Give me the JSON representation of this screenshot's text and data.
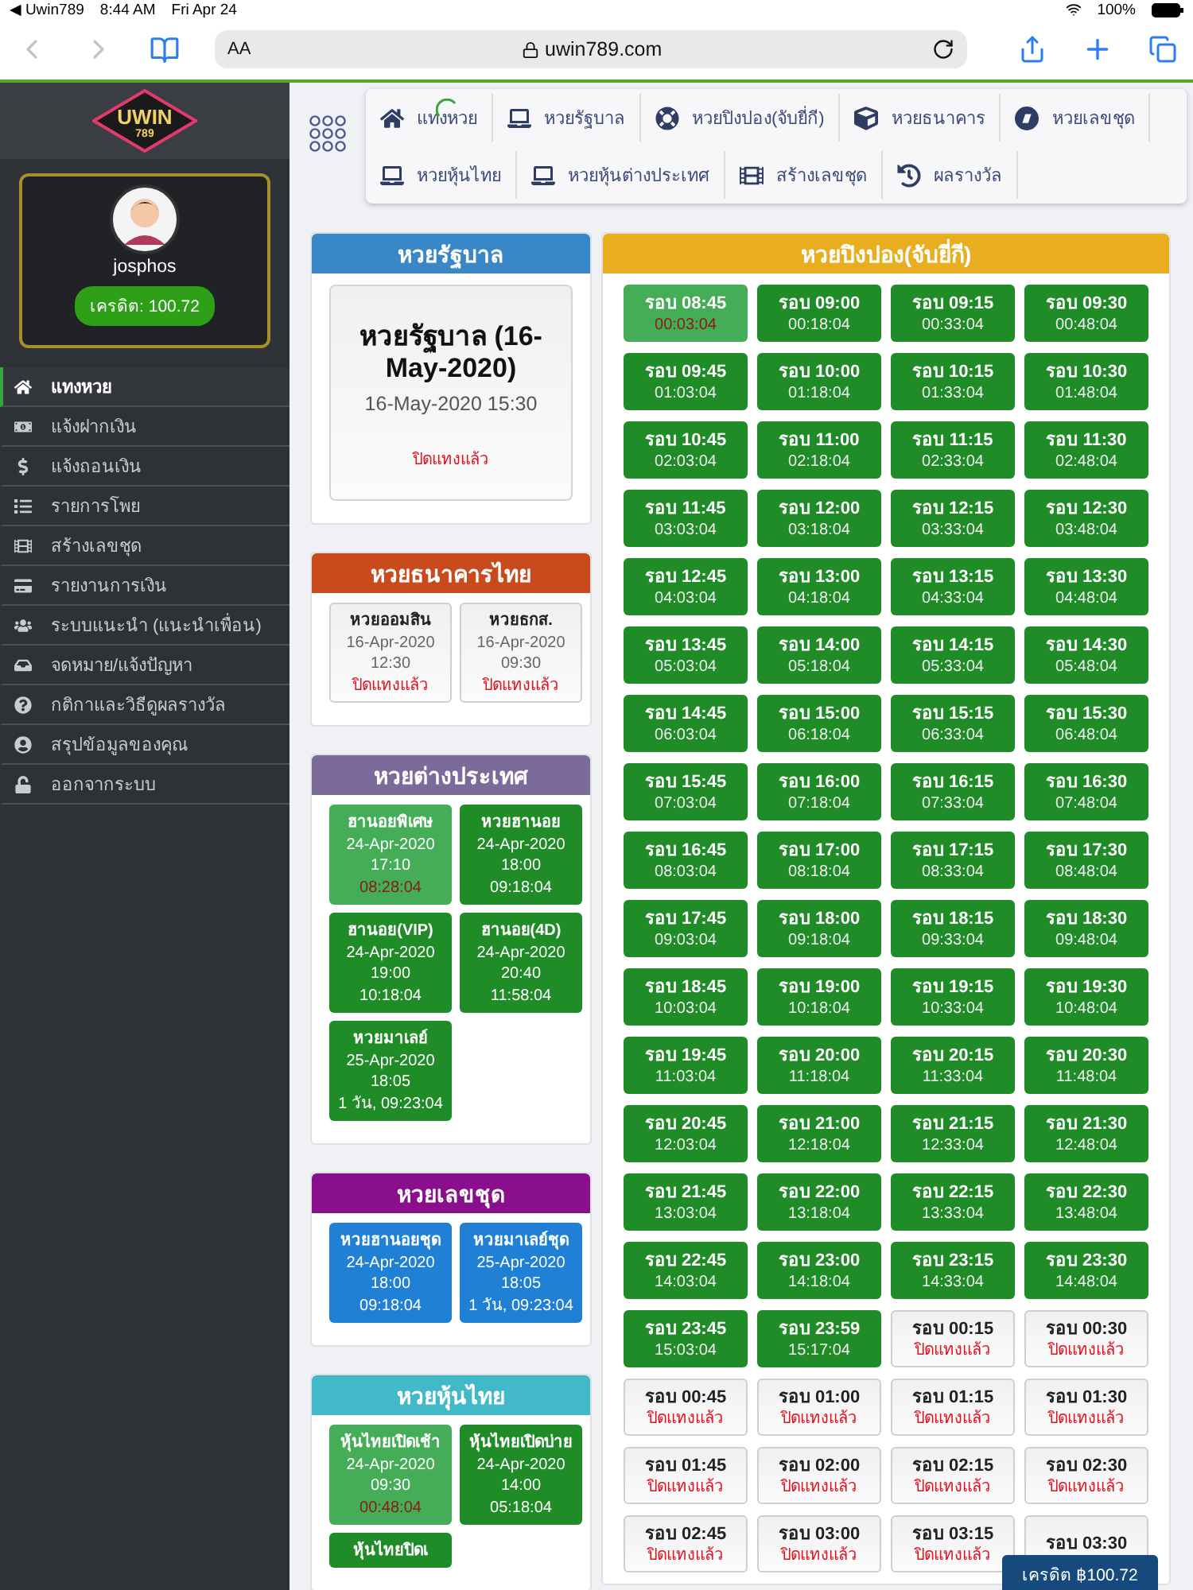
{
  "status_bar": {
    "back": "◀ Uwin789",
    "time": "8:44 AM",
    "date": "Fri Apr 24",
    "battery": "100%"
  },
  "browser": {
    "text_size": "AA",
    "url": "uwin789.com"
  },
  "logo": {
    "text": "UWIN",
    "number": "789"
  },
  "profile": {
    "username": "josphos",
    "credit": "เครดิต: 100.72"
  },
  "sidebar": {
    "items": [
      {
        "label": "แทงหวย",
        "selected": true
      },
      {
        "label": "แจ้งฝากเงิน",
        "selected": false
      },
      {
        "label": "แจ้งถอนเงิน",
        "selected": false
      },
      {
        "label": "รายการโพย",
        "selected": false
      },
      {
        "label": "สร้างเลขชุด",
        "selected": false
      },
      {
        "label": "รายงานการเงิน",
        "selected": false
      },
      {
        "label": "ระบบแนะนำ (แนะนำเพื่อน)",
        "selected": false
      },
      {
        "label": "จดหมาย/แจ้งปัญหา",
        "selected": false
      },
      {
        "label": "กติกาและวิธีดูผลรางวัล",
        "selected": false
      },
      {
        "label": "สรุปข้อมูลของคุณ",
        "selected": false
      },
      {
        "label": "ออกจากระบบ",
        "selected": false
      }
    ]
  },
  "nav": {
    "rows": [
      {
        "items": [
          {
            "label": "แทงหวย"
          },
          {
            "label": "หวยรัฐบาล"
          },
          {
            "label": "หวยปิงปอง(จับยี่กี)"
          },
          {
            "label": "หวยธนาคาร"
          },
          {
            "label": "หวยเลขชุด"
          }
        ]
      },
      {
        "items": [
          {
            "label": "หวยหุ้นไทย"
          },
          {
            "label": "หวยหุ้นต่างประเทศ"
          },
          {
            "label": "สร้างเลขชุด"
          },
          {
            "label": "ผลรางวัล"
          }
        ]
      }
    ]
  },
  "left_sections": [
    {
      "title": "หวยรัฐบาล",
      "color": "#3a87c8",
      "kind": "feature",
      "feature": {
        "title": "หวยรัฐบาล (16-May-2020)",
        "datetime": "16-May-2020 15:30",
        "note": "ปิดแทงแล้ว"
      }
    },
    {
      "title": "หวยธนาคารไทย",
      "color": "#c94a1c",
      "kind": "tiles",
      "tiles": [
        {
          "name": "หวยออมสิน",
          "date": "16-Apr-2020",
          "time": "12:30",
          "kind": "closed",
          "info": "ปิดแทงแล้ว"
        },
        {
          "name": "หวยธกส.",
          "date": "16-Apr-2020",
          "time": "09:30",
          "kind": "closed",
          "info": "ปิดแทงแล้ว"
        }
      ]
    },
    {
      "title": "หวยต่างประเทศ",
      "color": "#7b6b9b",
      "kind": "tiles",
      "tiles": [
        {
          "name": "ฮานอยพิเศษ",
          "date": "24-Apr-2020",
          "time": "17:10",
          "kind": "current",
          "info": "08:28:04"
        },
        {
          "name": "หวยฮานอย",
          "date": "24-Apr-2020",
          "time": "18:00",
          "kind": "open",
          "info": "09:18:04"
        },
        {
          "name": "ฮานอย(VIP)",
          "date": "24-Apr-2020",
          "time": "19:00",
          "kind": "open",
          "info": "10:18:04"
        },
        {
          "name": "ฮานอย(4D)",
          "date": "24-Apr-2020",
          "time": "20:40",
          "kind": "open",
          "info": "11:58:04"
        },
        {
          "name": "หวยมาเลย์",
          "date": "25-Apr-2020",
          "time": "18:05",
          "kind": "open",
          "info": "1 วัน, 09:23:04"
        }
      ]
    },
    {
      "title": "หวยเลขชุด",
      "color": "#8a0f8c",
      "kind": "tiles",
      "tiles": [
        {
          "name": "หวยฮานอยชุด",
          "date": "24-Apr-2020",
          "time": "18:00",
          "kind": "set",
          "info": "09:18:04"
        },
        {
          "name": "หวยมาเลย์ชุด",
          "date": "25-Apr-2020",
          "time": "18:05",
          "kind": "set",
          "info": "1 วัน, 09:23:04"
        }
      ]
    },
    {
      "title": "หวยหุ้นไทย",
      "color": "#41b9c9",
      "kind": "tiles",
      "tiles": [
        {
          "name": "หุ้นไทยเปิดเช้า",
          "date": "24-Apr-2020",
          "time": "09:30",
          "kind": "current",
          "info": "00:48:04"
        },
        {
          "name": "หุ้นไทยเปิดบ่าย",
          "date": "24-Apr-2020",
          "time": "14:00",
          "kind": "open",
          "info": "05:18:04"
        },
        {
          "name": "หุ้นไทยปิดเ",
          "kind": "open"
        }
      ]
    }
  ],
  "pingpong": {
    "title": "หวยปิงปอง(จับยี่กี)",
    "color": "#e9ae20",
    "rounds": [
      {
        "label": "รอบ 08:45",
        "kind": "current",
        "info": "00:03:04"
      },
      {
        "label": "รอบ 09:00",
        "kind": "open",
        "info": "00:18:04"
      },
      {
        "label": "รอบ 09:15",
        "kind": "open",
        "info": "00:33:04"
      },
      {
        "label": "รอบ 09:30",
        "kind": "open",
        "info": "00:48:04"
      },
      {
        "label": "รอบ 09:45",
        "kind": "open",
        "info": "01:03:04"
      },
      {
        "label": "รอบ 10:00",
        "kind": "open",
        "info": "01:18:04"
      },
      {
        "label": "รอบ 10:15",
        "kind": "open",
        "info": "01:33:04"
      },
      {
        "label": "รอบ 10:30",
        "kind": "open",
        "info": "01:48:04"
      },
      {
        "label": "รอบ 10:45",
        "kind": "open",
        "info": "02:03:04"
      },
      {
        "label": "รอบ 11:00",
        "kind": "open",
        "info": "02:18:04"
      },
      {
        "label": "รอบ 11:15",
        "kind": "open",
        "info": "02:33:04"
      },
      {
        "label": "รอบ 11:30",
        "kind": "open",
        "info": "02:48:04"
      },
      {
        "label": "รอบ 11:45",
        "kind": "open",
        "info": "03:03:04"
      },
      {
        "label": "รอบ 12:00",
        "kind": "open",
        "info": "03:18:04"
      },
      {
        "label": "รอบ 12:15",
        "kind": "open",
        "info": "03:33:04"
      },
      {
        "label": "รอบ 12:30",
        "kind": "open",
        "info": "03:48:04"
      },
      {
        "label": "รอบ 12:45",
        "kind": "open",
        "info": "04:03:04"
      },
      {
        "label": "รอบ 13:00",
        "kind": "open",
        "info": "04:18:04"
      },
      {
        "label": "รอบ 13:15",
        "kind": "open",
        "info": "04:33:04"
      },
      {
        "label": "รอบ 13:30",
        "kind": "open",
        "info": "04:48:04"
      },
      {
        "label": "รอบ 13:45",
        "kind": "open",
        "info": "05:03:04"
      },
      {
        "label": "รอบ 14:00",
        "kind": "open",
        "info": "05:18:04"
      },
      {
        "label": "รอบ 14:15",
        "kind": "open",
        "info": "05:33:04"
      },
      {
        "label": "รอบ 14:30",
        "kind": "open",
        "info": "05:48:04"
      },
      {
        "label": "รอบ 14:45",
        "kind": "open",
        "info": "06:03:04"
      },
      {
        "label": "รอบ 15:00",
        "kind": "open",
        "info": "06:18:04"
      },
      {
        "label": "รอบ 15:15",
        "kind": "open",
        "info": "06:33:04"
      },
      {
        "label": "รอบ 15:30",
        "kind": "open",
        "info": "06:48:04"
      },
      {
        "label": "รอบ 15:45",
        "kind": "open",
        "info": "07:03:04"
      },
      {
        "label": "รอบ 16:00",
        "kind": "open",
        "info": "07:18:04"
      },
      {
        "label": "รอบ 16:15",
        "kind": "open",
        "info": "07:33:04"
      },
      {
        "label": "รอบ 16:30",
        "kind": "open",
        "info": "07:48:04"
      },
      {
        "label": "รอบ 16:45",
        "kind": "open",
        "info": "08:03:04"
      },
      {
        "label": "รอบ 17:00",
        "kind": "open",
        "info": "08:18:04"
      },
      {
        "label": "รอบ 17:15",
        "kind": "open",
        "info": "08:33:04"
      },
      {
        "label": "รอบ 17:30",
        "kind": "open",
        "info": "08:48:04"
      },
      {
        "label": "รอบ 17:45",
        "kind": "open",
        "info": "09:03:04"
      },
      {
        "label": "รอบ 18:00",
        "kind": "open",
        "info": "09:18:04"
      },
      {
        "label": "รอบ 18:15",
        "kind": "open",
        "info": "09:33:04"
      },
      {
        "label": "รอบ 18:30",
        "kind": "open",
        "info": "09:48:04"
      },
      {
        "label": "รอบ 18:45",
        "kind": "open",
        "info": "10:03:04"
      },
      {
        "label": "รอบ 19:00",
        "kind": "open",
        "info": "10:18:04"
      },
      {
        "label": "รอบ 19:15",
        "kind": "open",
        "info": "10:33:04"
      },
      {
        "label": "รอบ 19:30",
        "kind": "open",
        "info": "10:48:04"
      },
      {
        "label": "รอบ 19:45",
        "kind": "open",
        "info": "11:03:04"
      },
      {
        "label": "รอบ 20:00",
        "kind": "open",
        "info": "11:18:04"
      },
      {
        "label": "รอบ 20:15",
        "kind": "open",
        "info": "11:33:04"
      },
      {
        "label": "รอบ 20:30",
        "kind": "open",
        "info": "11:48:04"
      },
      {
        "label": "รอบ 20:45",
        "kind": "open",
        "info": "12:03:04"
      },
      {
        "label": "รอบ 21:00",
        "kind": "open",
        "info": "12:18:04"
      },
      {
        "label": "รอบ 21:15",
        "kind": "open",
        "info": "12:33:04"
      },
      {
        "label": "รอบ 21:30",
        "kind": "open",
        "info": "12:48:04"
      },
      {
        "label": "รอบ 21:45",
        "kind": "open",
        "info": "13:03:04"
      },
      {
        "label": "รอบ 22:00",
        "kind": "open",
        "info": "13:18:04"
      },
      {
        "label": "รอบ 22:15",
        "kind": "open",
        "info": "13:33:04"
      },
      {
        "label": "รอบ 22:30",
        "kind": "open",
        "info": "13:48:04"
      },
      {
        "label": "รอบ 22:45",
        "kind": "open",
        "info": "14:03:04"
      },
      {
        "label": "รอบ 23:00",
        "kind": "open",
        "info": "14:18:04"
      },
      {
        "label": "รอบ 23:15",
        "kind": "open",
        "info": "14:33:04"
      },
      {
        "label": "รอบ 23:30",
        "kind": "open",
        "info": "14:48:04"
      },
      {
        "label": "รอบ 23:45",
        "kind": "open",
        "info": "15:03:04"
      },
      {
        "label": "รอบ 23:59",
        "kind": "open",
        "info": "15:17:04"
      },
      {
        "label": "รอบ 00:15",
        "kind": "closed",
        "info": "ปิดแทงแล้ว"
      },
      {
        "label": "รอบ 00:30",
        "kind": "closed",
        "info": "ปิดแทงแล้ว"
      },
      {
        "label": "รอบ 00:45",
        "kind": "closed",
        "info": "ปิดแทงแล้ว"
      },
      {
        "label": "รอบ 01:00",
        "kind": "closed",
        "info": "ปิดแทงแล้ว"
      },
      {
        "label": "รอบ 01:15",
        "kind": "closed",
        "info": "ปิดแทงแล้ว"
      },
      {
        "label": "รอบ 01:30",
        "kind": "closed",
        "info": "ปิดแทงแล้ว"
      },
      {
        "label": "รอบ 01:45",
        "kind": "closed",
        "info": "ปิดแทงแล้ว"
      },
      {
        "label": "รอบ 02:00",
        "kind": "closed",
        "info": "ปิดแทงแล้ว"
      },
      {
        "label": "รอบ 02:15",
        "kind": "closed",
        "info": "ปิดแทงแล้ว"
      },
      {
        "label": "รอบ 02:30",
        "kind": "closed",
        "info": "ปิดแทงแล้ว"
      },
      {
        "label": "รอบ 02:45",
        "kind": "closed",
        "info": "ปิดแทงแล้ว"
      },
      {
        "label": "รอบ 03:00",
        "kind": "closed",
        "info": "ปิดแทงแล้ว"
      },
      {
        "label": "รอบ 03:15",
        "kind": "closed",
        "info": "ปิดแทงแล้ว"
      },
      {
        "label": "รอบ 03:30",
        "kind": "closed"
      }
    ]
  },
  "credit_badge": "เครดิต ฿100.72"
}
